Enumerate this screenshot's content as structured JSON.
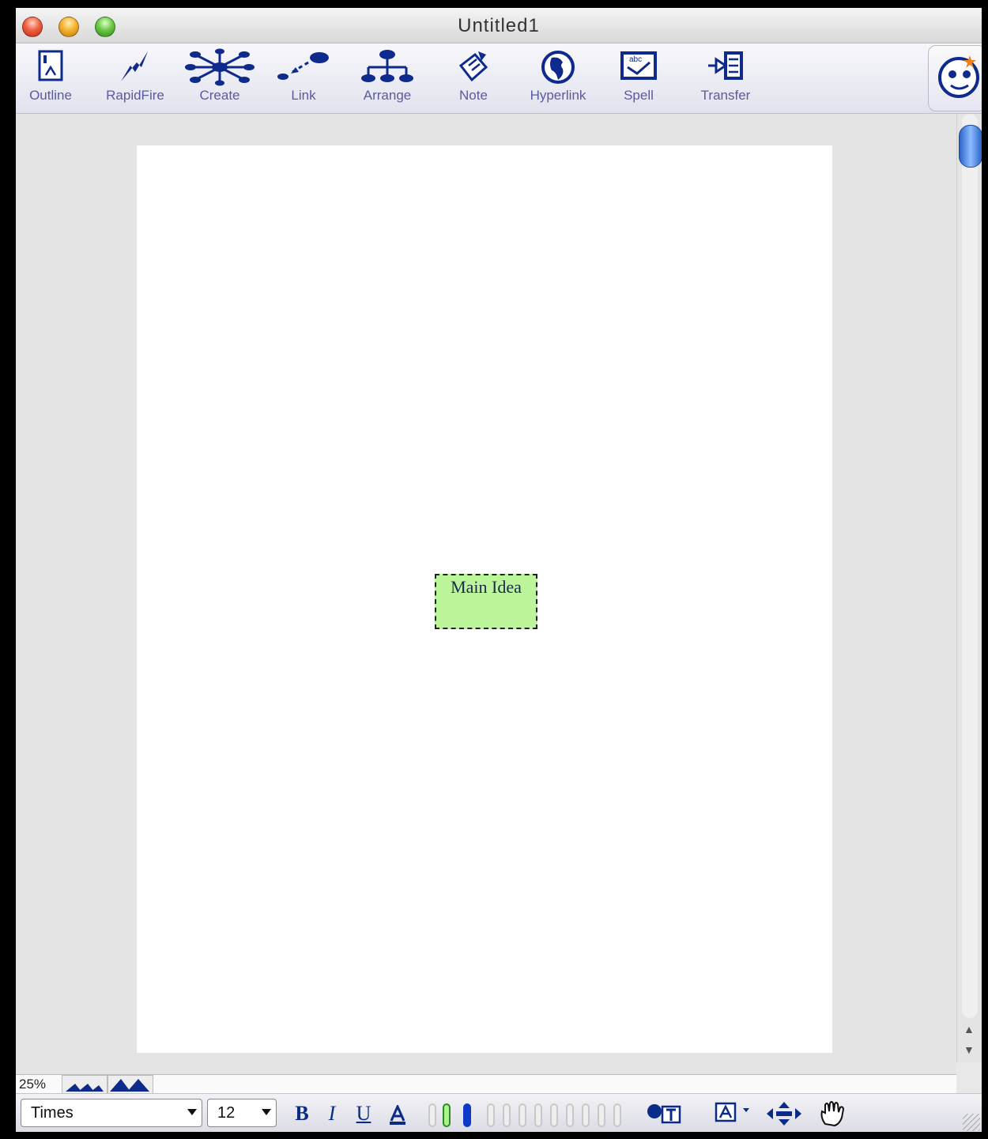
{
  "window": {
    "title": "Untitled1"
  },
  "toolbar": {
    "items": [
      {
        "label": "Outline",
        "icon": "outline-icon"
      },
      {
        "label": "RapidFire",
        "icon": "rapidfire-icon"
      },
      {
        "label": "Create",
        "icon": "create-icon"
      },
      {
        "label": "Link",
        "icon": "link-icon"
      },
      {
        "label": "Arrange",
        "icon": "arrange-icon"
      },
      {
        "label": "Note",
        "icon": "note-icon"
      },
      {
        "label": "Hyperlink",
        "icon": "hyperlink-icon"
      },
      {
        "label": "Spell",
        "icon": "spell-icon"
      },
      {
        "label": "Transfer",
        "icon": "transfer-icon"
      }
    ],
    "badge_icon": "kidspiration-mascot-icon",
    "icon_color": "#0d2a8c"
  },
  "canvas": {
    "node": {
      "label": "Main Idea",
      "fill": "#bdf59b"
    }
  },
  "zoom": {
    "value": "25%"
  },
  "format": {
    "font_name": "Times",
    "font_size": "12",
    "bold_label": "B",
    "italic_label": "I",
    "underline_label": "U"
  }
}
